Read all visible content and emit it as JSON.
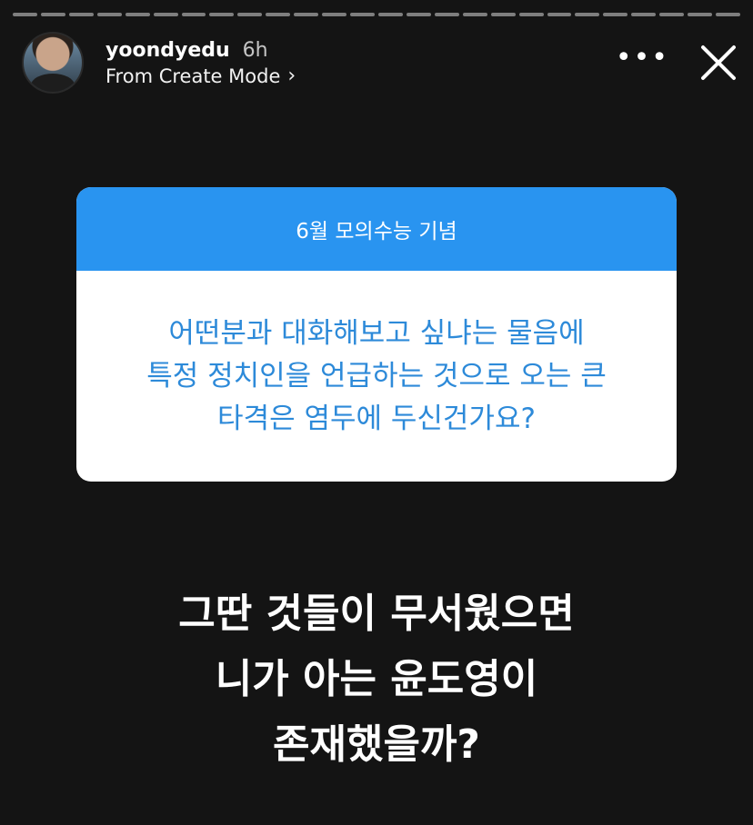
{
  "story": {
    "progress_segments": 26
  },
  "header": {
    "username": "yoondyedu",
    "time": "6h",
    "subtitle": "From Create Mode",
    "subtitle_chevron": "›",
    "more_label": "•••"
  },
  "question_card": {
    "title": "6월 모의수능 기념",
    "lines": [
      "어떤분과 대화해보고 싶냐는 물음에",
      "특정 정치인을 언급하는 것으로 오는 큰",
      "타격은 염두에 두신건가요?"
    ],
    "colors": {
      "header": "#2994f0",
      "text": "#2d8ad9"
    }
  },
  "answer": {
    "lines": [
      "그딴 것들이 무서웠으면",
      "니가 아는 윤도영이",
      "존재했을까?"
    ]
  },
  "colors": {
    "background": "#141414"
  }
}
